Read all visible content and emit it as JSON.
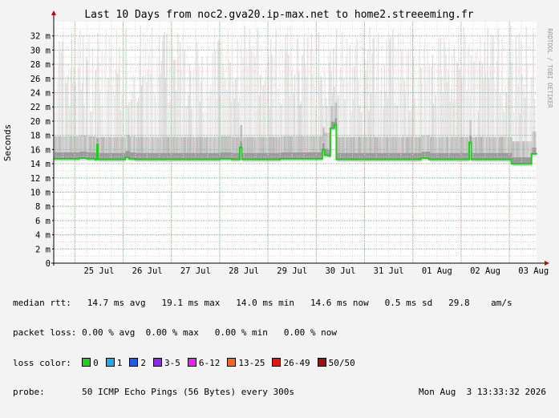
{
  "chart_data": {
    "type": "area",
    "title": "Last 10 Days from noc2.gva20.ip-max.net to home2.streeeming.fr",
    "ylabel": "Seconds",
    "watermark": "RRDTOOL / TOBI OETIKER",
    "y_unit": "ms",
    "ylim": [
      0,
      34
    ],
    "y_ticks": [
      {
        "v": 0,
        "label": "0"
      },
      {
        "v": 2,
        "label": "2 m"
      },
      {
        "v": 4,
        "label": "4 m"
      },
      {
        "v": 6,
        "label": "6 m"
      },
      {
        "v": 8,
        "label": "8 m"
      },
      {
        "v": 10,
        "label": "10 m"
      },
      {
        "v": 12,
        "label": "12 m"
      },
      {
        "v": 14,
        "label": "14 m"
      },
      {
        "v": 16,
        "label": "16 m"
      },
      {
        "v": 18,
        "label": "18 m"
      },
      {
        "v": 20,
        "label": "20 m"
      },
      {
        "v": 22,
        "label": "22 m"
      },
      {
        "v": 24,
        "label": "24 m"
      },
      {
        "v": 26,
        "label": "26 m"
      },
      {
        "v": 28,
        "label": "28 m"
      },
      {
        "v": 30,
        "label": "30 m"
      },
      {
        "v": 32,
        "label": "32 m"
      }
    ],
    "xlim": [
      "2026-07-24 13:30",
      "2026-08-03 13:30"
    ],
    "x_ticks": [
      {
        "date": "2026-07-25 12:00",
        "label": "25 Jul"
      },
      {
        "date": "2026-07-26 12:00",
        "label": "26 Jul"
      },
      {
        "date": "2026-07-27 12:00",
        "label": "27 Jul"
      },
      {
        "date": "2026-07-28 12:00",
        "label": "28 Jul"
      },
      {
        "date": "2026-07-29 12:00",
        "label": "29 Jul"
      },
      {
        "date": "2026-07-30 12:00",
        "label": "30 Jul"
      },
      {
        "date": "2026-07-31 12:00",
        "label": "31 Jul"
      },
      {
        "date": "2026-08-01 12:00",
        "label": "01 Aug"
      },
      {
        "date": "2026-08-02 12:00",
        "label": "02 Aug"
      },
      {
        "date": "2026-08-03 12:00",
        "label": "03 Aug"
      }
    ],
    "grid": true,
    "series": [
      {
        "name": "median rtt",
        "color": "#22cc22",
        "points": [
          [
            "2026-07-24 13:30",
            14.7
          ],
          [
            "2026-07-25 00:00",
            14.7
          ],
          [
            "2026-07-25 02:00",
            14.8
          ],
          [
            "2026-07-25 06:00",
            14.7
          ],
          [
            "2026-07-25 10:00",
            14.6
          ],
          [
            "2026-07-25 11:00",
            16.7
          ],
          [
            "2026-07-25 11:30",
            14.6
          ],
          [
            "2026-07-26 00:00",
            14.6
          ],
          [
            "2026-07-26 01:00",
            14.9
          ],
          [
            "2026-07-26 03:00",
            14.7
          ],
          [
            "2026-07-26 06:00",
            14.6
          ],
          [
            "2026-07-27 00:00",
            14.6
          ],
          [
            "2026-07-27 12:00",
            14.6
          ],
          [
            "2026-07-28 00:00",
            14.7
          ],
          [
            "2026-07-28 06:00",
            14.6
          ],
          [
            "2026-07-28 10:00",
            16.3
          ],
          [
            "2026-07-28 11:00",
            14.6
          ],
          [
            "2026-07-29 00:00",
            14.6
          ],
          [
            "2026-07-29 06:00",
            14.7
          ],
          [
            "2026-07-30 00:00",
            14.7
          ],
          [
            "2026-07-30 03:00",
            16.0
          ],
          [
            "2026-07-30 04:00",
            15.2
          ],
          [
            "2026-07-30 06:00",
            15.1
          ],
          [
            "2026-07-30 07:00",
            19.0
          ],
          [
            "2026-07-30 09:00",
            19.5
          ],
          [
            "2026-07-30 10:00",
            14.6
          ],
          [
            "2026-07-31 00:00",
            14.6
          ],
          [
            "2026-07-31 12:00",
            14.6
          ],
          [
            "2026-08-01 00:00",
            14.6
          ],
          [
            "2026-08-01 04:00",
            14.8
          ],
          [
            "2026-08-01 08:00",
            14.6
          ],
          [
            "2026-08-02 00:00",
            14.6
          ],
          [
            "2026-08-02 04:00",
            17.0
          ],
          [
            "2026-08-02 05:00",
            14.6
          ],
          [
            "2026-08-03 00:00",
            14.6
          ],
          [
            "2026-08-03 01:00",
            14.0
          ],
          [
            "2026-08-03 10:00",
            14.0
          ],
          [
            "2026-08-03 11:00",
            15.4
          ],
          [
            "2026-08-03 13:30",
            15.3
          ]
        ]
      }
    ],
    "smoke_max_ms": 33.5,
    "legend": {
      "median_rtt": {
        "label": "median rtt:",
        "avg": "14.7 ms avg",
        "max": "19.1 ms max",
        "min": "14.0 ms min",
        "now": "14.6 ms now",
        "sd": "0.5 ms sd",
        "am": "29.8",
        "am_unit": "am/s"
      },
      "packet_loss": {
        "label": "packet loss:",
        "avg": "0.00 % avg",
        "max": "0.00 % max",
        "min": "0.00 % min",
        "now": "0.00 % now"
      },
      "loss_color": {
        "label": "loss color:",
        "items": [
          {
            "label": "0",
            "color": "#22cc22"
          },
          {
            "label": "1",
            "color": "#22aaee"
          },
          {
            "label": "2",
            "color": "#1a5cee"
          },
          {
            "label": "3-5",
            "color": "#8a2be2"
          },
          {
            "label": "6-12",
            "color": "#ee22ee"
          },
          {
            "label": "13-25",
            "color": "#ee6622"
          },
          {
            "label": "26-49",
            "color": "#ee1111"
          },
          {
            "label": "50/50",
            "color": "#a01010"
          }
        ]
      },
      "probe": {
        "label": "probe:",
        "text": "50 ICMP Echo Pings (56 Bytes) every 300s",
        "date": "Mon Aug  3 13:33:32 2026"
      }
    }
  }
}
